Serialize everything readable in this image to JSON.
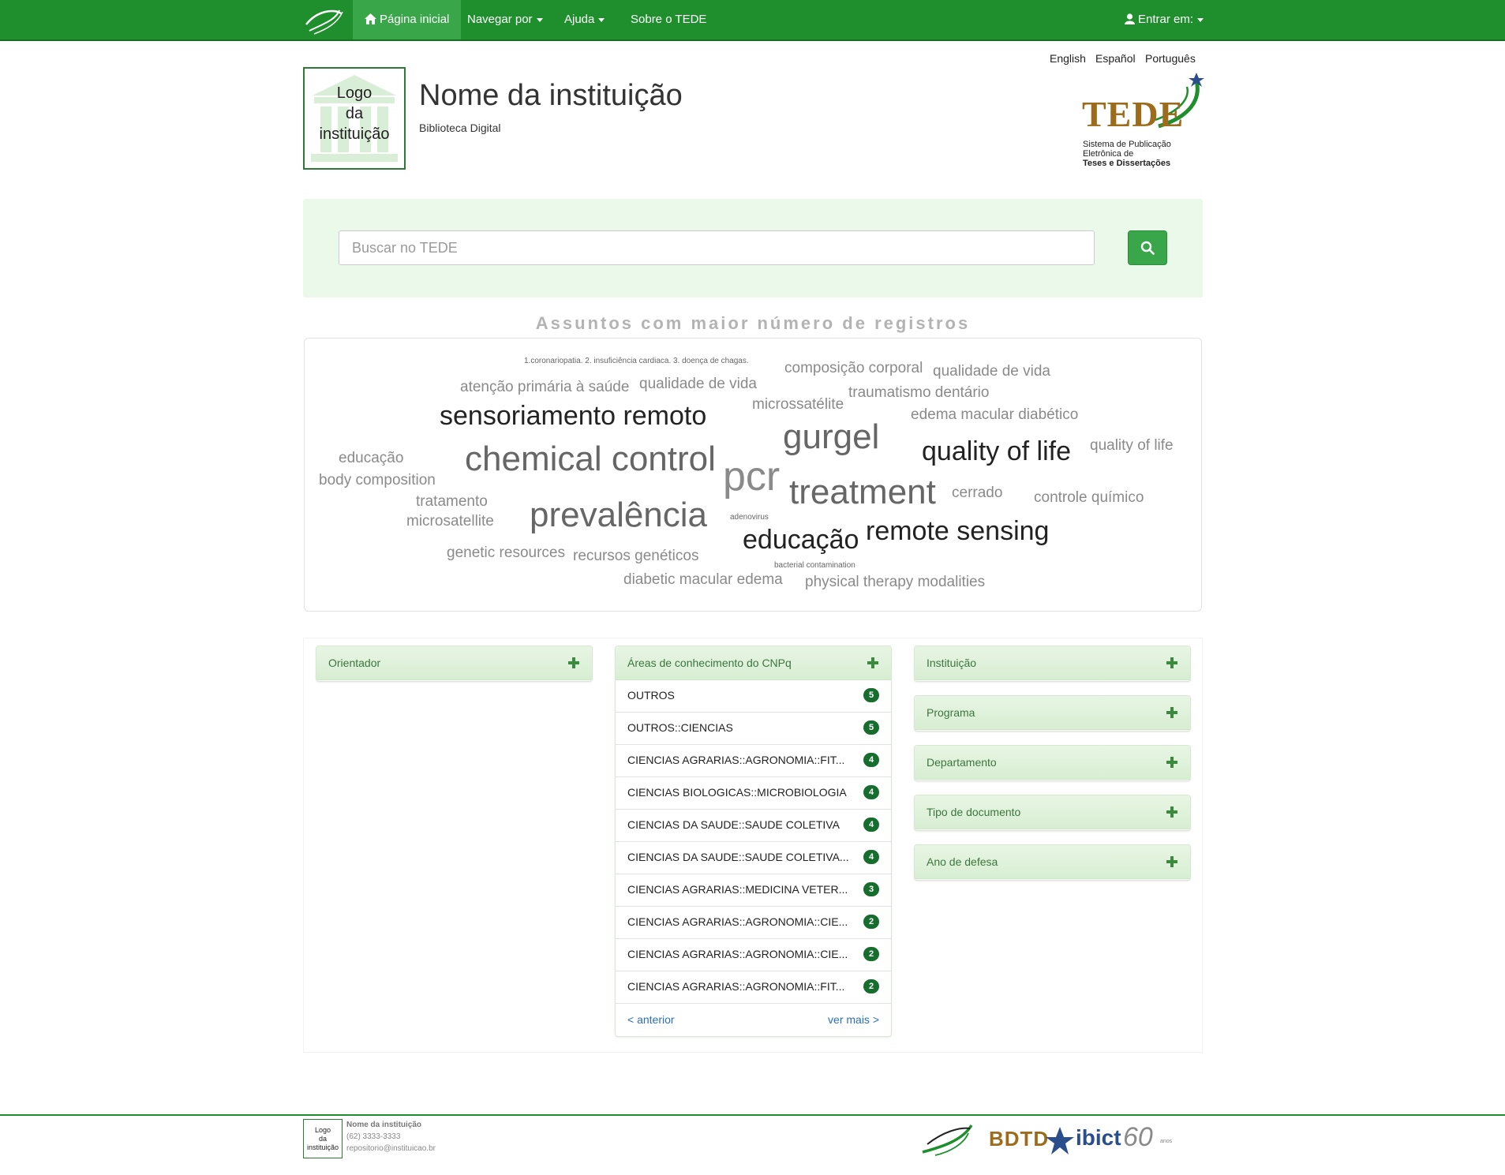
{
  "navbar": {
    "home": "Página inicial",
    "browse": "Navegar por",
    "help": "Ajuda",
    "about": "Sobre o TEDE",
    "login": "Entrar em:"
  },
  "languages": [
    "English",
    "Español",
    "Português"
  ],
  "institution": {
    "logo_text_1": "Logo",
    "logo_text_2": "da",
    "logo_text_3": "instituição",
    "name": "Nome da instituição",
    "subtitle": "Biblioteca Digital"
  },
  "tede_logo": {
    "word": "TEDE",
    "line1": "Sistema de Publicação",
    "line2": "Eletrônica de",
    "line3": "Teses e Dissertações"
  },
  "search": {
    "placeholder": "Buscar no TEDE"
  },
  "cloud": {
    "title": "Assuntos com maior número de registros",
    "tags": [
      "1.coronariopatia. 2. insuficiência cardiaca. 3. doença de chagas.",
      "composição corporal",
      "qualidade de vida",
      "atenção primária à saúde",
      "qualidade de vida",
      "microssatélite",
      "traumatismo dentário",
      "sensoriamento remoto",
      "edema macular diabético",
      "gurgel",
      "educação",
      "chemical control",
      "quality of life",
      "quality of life",
      "body composition",
      "pcr",
      "treatment",
      "cerrado",
      "controle químico",
      "tratamento",
      "prevalência",
      "microsatellite",
      "adenovirus",
      "educação",
      "remote sensing",
      "genetic resources",
      "recursos genéticos",
      "bacterial contamination",
      "diabetic macular edema",
      "physical therapy modalities"
    ]
  },
  "facets": {
    "orientador": "Orientador",
    "cnpq": {
      "title": "Áreas de conhecimento do CNPq",
      "items": [
        {
          "label": "OUTROS",
          "count": "5"
        },
        {
          "label": "OUTROS::CIENCIAS",
          "count": "5"
        },
        {
          "label": "CIENCIAS AGRARIAS::AGRONOMIA::FIT...",
          "count": "4"
        },
        {
          "label": "CIENCIAS BIOLOGICAS::MICROBIOLOGIA",
          "count": "4"
        },
        {
          "label": "CIENCIAS DA SAUDE::SAUDE COLETIVA",
          "count": "4"
        },
        {
          "label": "CIENCIAS DA SAUDE::SAUDE COLETIVA...",
          "count": "4"
        },
        {
          "label": "CIENCIAS AGRARIAS::MEDICINA VETER...",
          "count": "3"
        },
        {
          "label": "CIENCIAS AGRARIAS::AGRONOMIA::CIE...",
          "count": "2"
        },
        {
          "label": "CIENCIAS AGRARIAS::AGRONOMIA::CIE...",
          "count": "2"
        },
        {
          "label": "CIENCIAS AGRARIAS::AGRONOMIA::FIT...",
          "count": "2"
        }
      ],
      "prev": "< anterior",
      "next": "ver mais >"
    },
    "right": [
      "Instituição",
      "Programa",
      "Departamento",
      "Tipo de documento",
      "Ano de defesa"
    ]
  },
  "footer": {
    "logo_text_1": "Logo",
    "logo_text_2": "da",
    "logo_text_3": "instituição",
    "name": "Nome da instituição",
    "phone": "(62) 3333-3333",
    "email": "repositorio@instituicao.br",
    "bdtd": "BDTD",
    "ibict": "ibict",
    "sixty": "60",
    "anos": "anos"
  }
}
